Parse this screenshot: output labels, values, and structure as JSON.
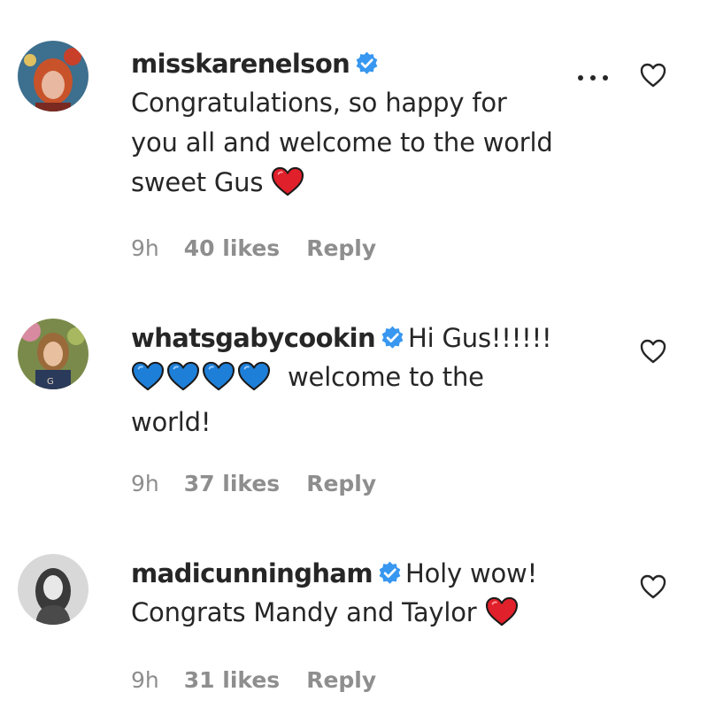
{
  "comments": [
    {
      "username": "misskarenelson",
      "text_lines": [
        "Congratulations, so happy for",
        "you all and welcome to the world",
        "sweet Gus"
      ],
      "emoji": "red-heart",
      "time": "9h",
      "likes": "40 likes",
      "reply": "Reply",
      "verified": true
    },
    {
      "username": "whatsgabycookin",
      "text_first": "Hi Gus!!!!!!",
      "text_second": "welcome to the",
      "text_third": "world!",
      "emoji": "blue-heart x4",
      "time": "9h",
      "likes": "37 likes",
      "reply": "Reply",
      "verified": true
    },
    {
      "username": "madicunningham",
      "text_first": "Holy wow!",
      "text_second": "Congrats Mandy and Taylor",
      "emoji": "red-heart",
      "time": "9h",
      "likes": "31 likes",
      "reply": "Reply",
      "verified": true
    }
  ],
  "colors": {
    "text": "#262626",
    "meta": "#8e8e8e",
    "verified": "#3897f0",
    "red_heart": "#e0202a",
    "blue_heart": "#1e7fd8"
  },
  "icons": {
    "verified": "verified-badge-icon",
    "like": "heart-outline-icon",
    "more": "more-options-icon"
  }
}
